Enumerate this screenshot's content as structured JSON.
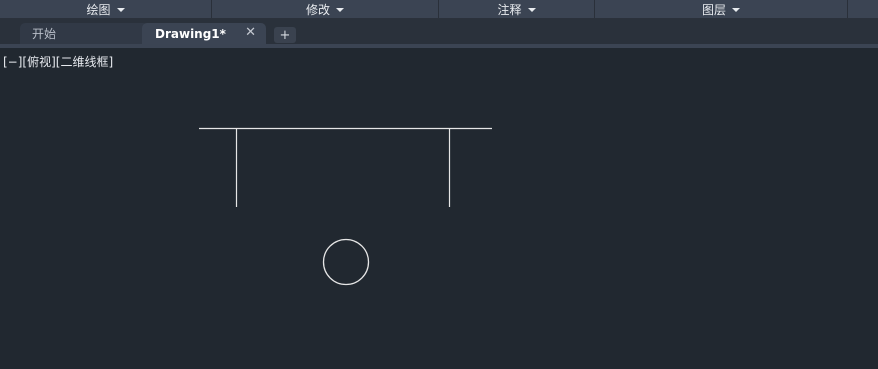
{
  "ribbon": {
    "panels": [
      {
        "label": "绘图"
      },
      {
        "label": "修改"
      },
      {
        "label": "注释"
      },
      {
        "label": "图层"
      }
    ]
  },
  "tabs": {
    "start_label": "开始",
    "drawing_label": "Drawing1*",
    "close_glyph": "✕",
    "add_glyph": "+"
  },
  "viewport": {
    "controls_prefix": "[−]",
    "view_label": "[俯视]",
    "visual_style_label": "[二维线框]"
  },
  "colors": {
    "background": "#212830",
    "ribbon_bar": "#3b4453",
    "geometry": "#e6e6e6"
  }
}
